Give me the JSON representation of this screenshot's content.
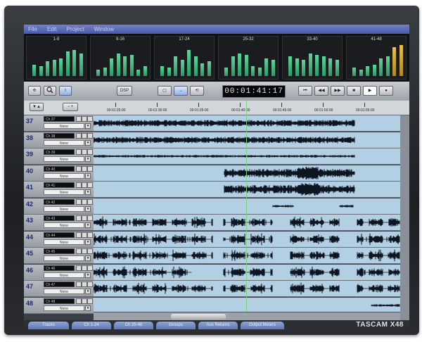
{
  "menu": [
    "File",
    "Edit",
    "Project",
    "Window"
  ],
  "meter_groups": [
    {
      "label": "1-8",
      "levels": [
        0.35,
        0.3,
        0.45,
        0.5,
        0.55,
        0.75,
        0.8,
        0.7
      ]
    },
    {
      "label": "9-16",
      "levels": [
        0.2,
        0.25,
        0.55,
        0.7,
        0.6,
        0.65,
        0.2,
        0.3
      ]
    },
    {
      "label": "17-24",
      "levels": [
        0.3,
        0.25,
        0.6,
        0.5,
        0.8,
        0.6,
        0.4,
        0.45
      ]
    },
    {
      "label": "25-32",
      "levels": [
        0.25,
        0.6,
        0.7,
        0.65,
        0.3,
        0.25,
        0.55,
        0.5
      ]
    },
    {
      "label": "33-40",
      "levels": [
        0.6,
        0.55,
        0.5,
        0.7,
        0.65,
        0.6,
        0.55,
        0.5
      ]
    },
    {
      "label": "41-48",
      "levels": [
        0.25,
        0.2,
        0.3,
        0.35,
        0.55,
        0.6,
        0.9,
        0.95
      ]
    }
  ],
  "toolbar": {
    "dsp_label": "DSP",
    "timecode": "00:01:41:17"
  },
  "ruler": [
    "00:01:25:00",
    "00:01:30:00",
    "00:01:35:00",
    "00:01:40:00",
    "00:01:45:00",
    "00:01:50:00",
    "00:01:55:00"
  ],
  "tracks": [
    {
      "num": "37",
      "name": "Ch 37",
      "input": "None"
    },
    {
      "num": "38",
      "name": "Ch 38",
      "input": "None"
    },
    {
      "num": "39",
      "name": "Ch 39",
      "input": "None"
    },
    {
      "num": "40",
      "name": "Ch 40",
      "input": "None"
    },
    {
      "num": "41",
      "name": "Ch 41",
      "input": "None"
    },
    {
      "num": "42",
      "name": "Ch 42",
      "input": "None"
    },
    {
      "num": "43",
      "name": "Ch 43",
      "input": "None"
    },
    {
      "num": "44",
      "name": "Ch 44",
      "input": "None"
    },
    {
      "num": "45",
      "name": "Ch 45",
      "input": "None"
    },
    {
      "num": "46",
      "name": "Ch 46",
      "input": "None"
    },
    {
      "num": "47",
      "name": "Ch 47",
      "input": "None"
    },
    {
      "num": "48",
      "name": "Ch 48",
      "input": "None"
    }
  ],
  "tabs": [
    "Tracks",
    "Ch 1-24",
    "Ch 25-48",
    "Groups",
    "Aux Returns",
    "Output Meters"
  ],
  "brand": "TASCAM X48"
}
